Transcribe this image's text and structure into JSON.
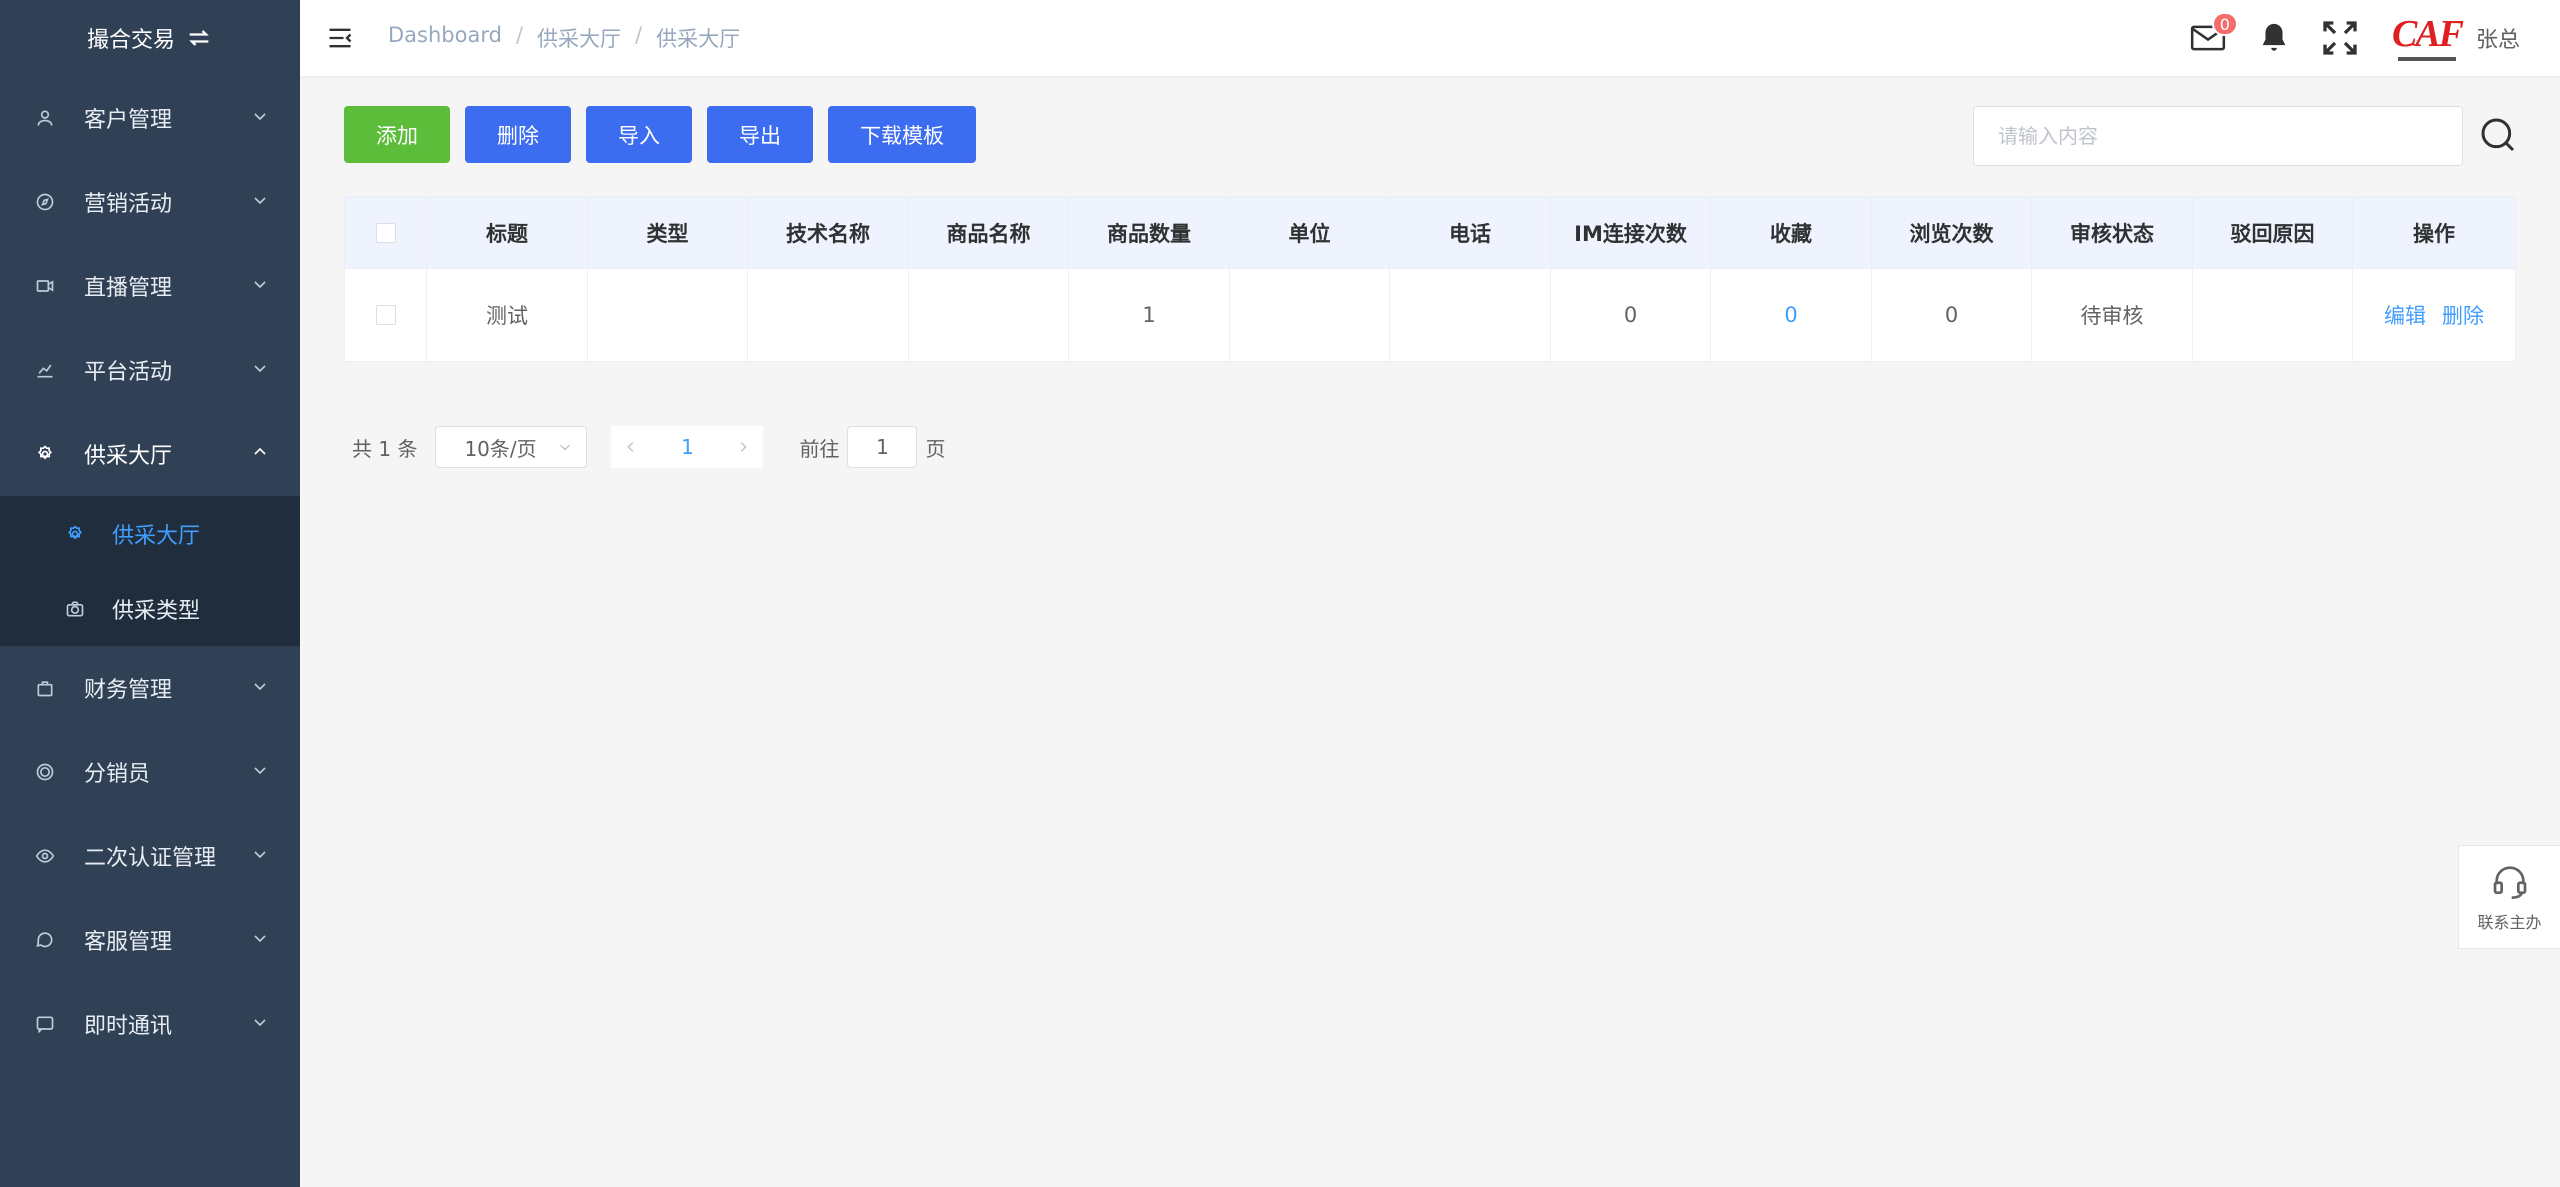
{
  "sidebar": {
    "brand": "撮合交易",
    "items": [
      {
        "label": "客户管理",
        "icon": "user-icon"
      },
      {
        "label": "营销活动",
        "icon": "compass-icon"
      },
      {
        "label": "直播管理",
        "icon": "video-icon"
      },
      {
        "label": "平台活动",
        "icon": "chart-icon"
      },
      {
        "label": "供采大厅",
        "icon": "gear-icon",
        "open": true
      },
      {
        "label": "财务管理",
        "icon": "bag-icon"
      },
      {
        "label": "分销员",
        "icon": "coin-icon"
      },
      {
        "label": "二次认证管理",
        "icon": "eye-icon"
      },
      {
        "label": "客服管理",
        "icon": "chat-icon"
      },
      {
        "label": "即时通讯",
        "icon": "message-icon"
      }
    ],
    "submenu": [
      {
        "label": "供采大厅",
        "icon": "gear-icon",
        "active": true
      },
      {
        "label": "供采类型",
        "icon": "camera-icon"
      }
    ]
  },
  "header": {
    "breadcrumb": [
      "Dashboard",
      "供采大厅",
      "供采大厅"
    ],
    "mail_badge": "0",
    "logo_text": "CAF",
    "username": "张总"
  },
  "toolbar": {
    "add": "添加",
    "delete": "删除",
    "import": "导入",
    "export": "导出",
    "download_template": "下载模板",
    "search_placeholder": "请输入内容"
  },
  "table": {
    "columns": [
      "标题",
      "类型",
      "技术名称",
      "商品名称",
      "商品数量",
      "单位",
      "电话",
      "IM连接次数",
      "收藏",
      "浏览次数",
      "审核状态",
      "驳回原因",
      "操作"
    ],
    "rows": [
      {
        "title": "测试",
        "type": "",
        "tech_name": "",
        "product_name": "",
        "quantity": "1",
        "unit": "",
        "phone": "",
        "im_count": "0",
        "favorites": "0",
        "views": "0",
        "status": "待审核",
        "reject_reason": "",
        "edit": "编辑",
        "delete": "删除"
      }
    ]
  },
  "pagination": {
    "total": "共 1 条",
    "page_size": "10条/页",
    "current": "1",
    "goto_prefix": "前往",
    "goto_value": "1",
    "goto_suffix": "页"
  },
  "contact": {
    "label": "联系主办"
  },
  "colors": {
    "sidebar_bg": "#304156",
    "submenu_bg": "#1f2d3d",
    "primary": "#3c6cf0",
    "success": "#5cbd3a",
    "link": "#409eff",
    "badge": "#f56c6c"
  }
}
